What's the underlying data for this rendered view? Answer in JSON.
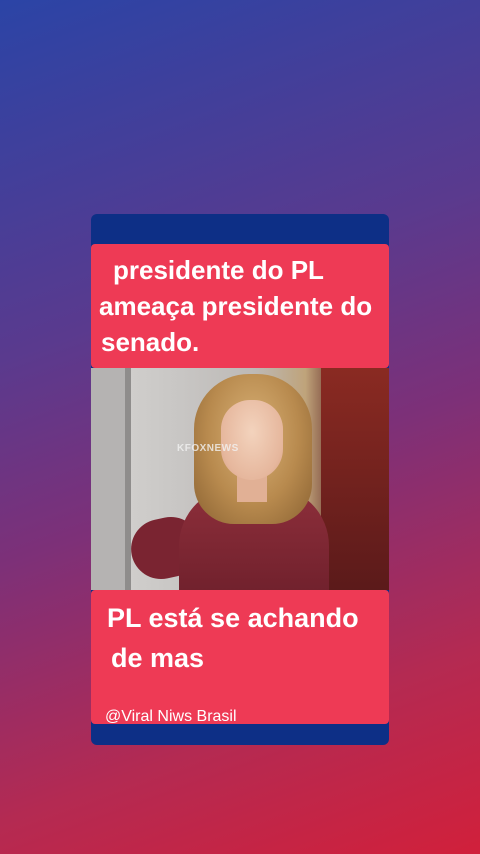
{
  "headline": {
    "line1": "presidente do PL",
    "line2": "ameaça presidente do",
    "line3": "senado."
  },
  "video": {
    "watermark": "KFOXNEWS"
  },
  "caption": {
    "line1": "PL está se achando",
    "line2": "de mas"
  },
  "credit": "@Viral Niws Brasil",
  "colors": {
    "banner": "#ee3a55",
    "card": "#0d2f86",
    "text": "#ffffff"
  }
}
